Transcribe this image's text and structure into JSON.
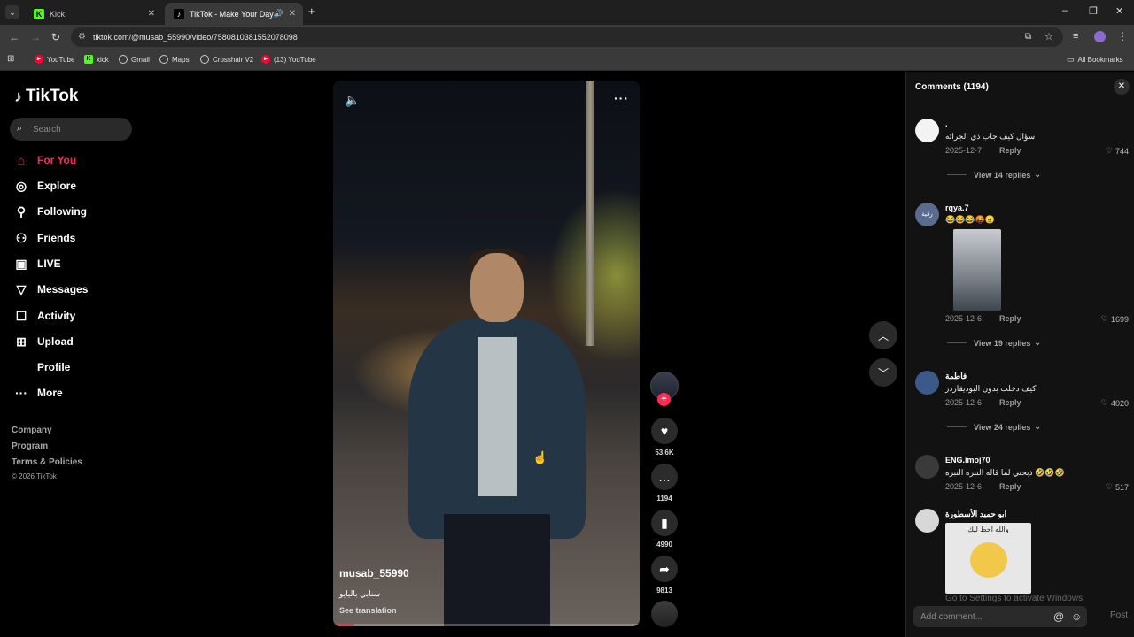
{
  "browser": {
    "tabs": [
      {
        "title": "Kick",
        "favicon": "kick-icon",
        "color": "#53fc18"
      },
      {
        "title": "TikTok - Make Your Day",
        "favicon": "tiktok-icon"
      }
    ],
    "new_tab_glyph": "+",
    "url": "tiktok.com/@musab_55990/video/7580810381552078098",
    "bookmarks": [
      {
        "label": "YouTube",
        "icon": "youtube-icon"
      },
      {
        "label": "kick",
        "icon": "kick-icon"
      },
      {
        "label": "Gmail",
        "icon": "globe-icon"
      },
      {
        "label": "Maps",
        "icon": "globe-icon"
      },
      {
        "label": "Crosshair V2",
        "icon": "globe-icon"
      },
      {
        "label": "(13) YouTube",
        "icon": "youtube-icon"
      }
    ],
    "all_bookmarks": "All Bookmarks"
  },
  "sidebar": {
    "logo": "TikTok",
    "search_placeholder": "Search",
    "nav": [
      {
        "label": "For You",
        "icon": "home-icon",
        "active": true
      },
      {
        "label": "Explore",
        "icon": "compass-icon"
      },
      {
        "label": "Following",
        "icon": "following-icon"
      },
      {
        "label": "Friends",
        "icon": "friends-icon"
      },
      {
        "label": "LIVE",
        "icon": "live-icon"
      },
      {
        "label": "Messages",
        "icon": "messages-icon"
      },
      {
        "label": "Activity",
        "icon": "activity-icon"
      },
      {
        "label": "Upload",
        "icon": "upload-icon"
      },
      {
        "label": "Profile",
        "icon": "profile-icon"
      },
      {
        "label": "More",
        "icon": "more-icon"
      }
    ],
    "footer": [
      "Company",
      "Program",
      "Terms & Policies",
      "© 2026 TikTok"
    ]
  },
  "video": {
    "username": "musab_55990",
    "caption": "سنابي باليايو",
    "see_translation": "See translation",
    "progress": 0.07
  },
  "actions": {
    "likes": "53.6K",
    "comments": "1194",
    "saves": "4990",
    "shares": "9813"
  },
  "comments": {
    "title": "Comments (1194)",
    "items": [
      {
        "name": ".",
        "text": "سؤال كيف جاب ذي الجرائه",
        "date": "2025-12-7",
        "reply": "Reply",
        "likes": "744",
        "more": "View 14 replies",
        "avatar_color": "#f3f3f3"
      },
      {
        "name": "rqya.7",
        "text": "😂😂😂🤬😠",
        "date": "2025-12-6",
        "reply": "Reply",
        "likes": "1699",
        "more": "View 19 replies",
        "avatar_color": "#5b6b8f",
        "avatar_text": "رقية"
      },
      {
        "name": "فاطمة",
        "text": "كيف دخلت بدون البوديقاردز",
        "date": "2025-12-6",
        "reply": "Reply",
        "likes": "4020",
        "more": "View 24 replies",
        "avatar_color": "#3b5a8a"
      },
      {
        "name": "ENG.imoj70",
        "text": "ذبحني لما قاله النبره النبره 🤣🤣🤣",
        "date": "2025-12-6",
        "reply": "Reply",
        "likes": "517",
        "avatar_color": "#3a3a3a"
      },
      {
        "name": "ابو حميد الأسطورة",
        "sticker_caption": "والله احط ليك",
        "avatar_color": "#d8d8d8"
      }
    ],
    "watermark": "Go to Settings to activate Windows.",
    "input_placeholder": "Add comment...",
    "post": "Post"
  }
}
